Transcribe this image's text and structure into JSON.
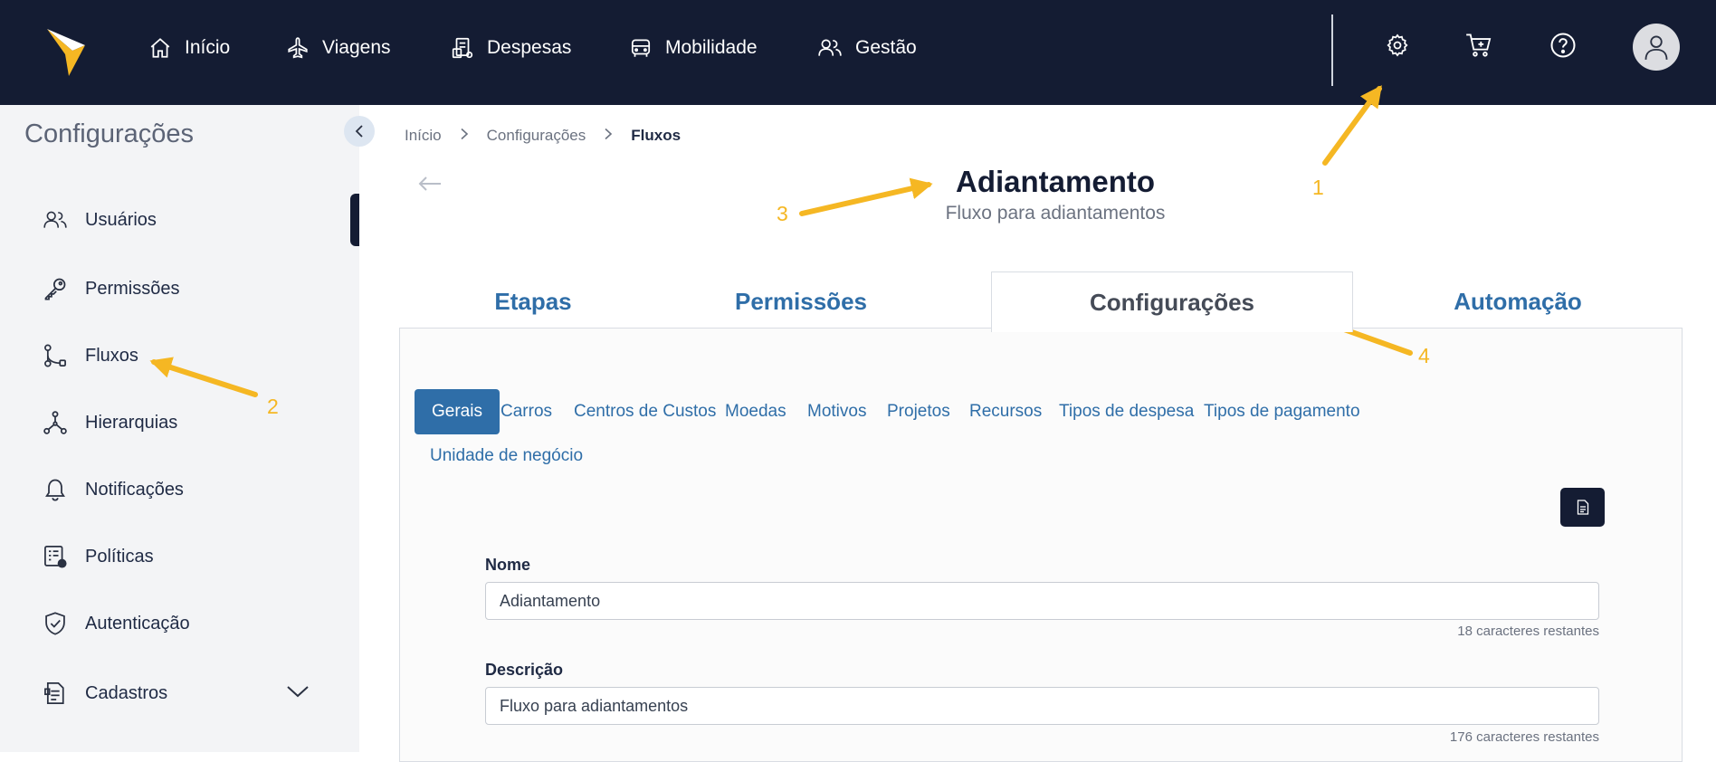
{
  "topnav": {
    "items": [
      {
        "label": "Início",
        "icon": "home-icon"
      },
      {
        "label": "Viagens",
        "icon": "airplane-icon"
      },
      {
        "label": "Despesas",
        "icon": "receipt-icon"
      },
      {
        "label": "Mobilidade",
        "icon": "car-icon"
      },
      {
        "label": "Gestão",
        "icon": "users-icon"
      }
    ],
    "right_icons": [
      "gear-icon",
      "cart-icon",
      "help-icon",
      "user-avatar-icon"
    ]
  },
  "sidebar": {
    "title": "Configurações",
    "items": [
      {
        "label": "Usuários",
        "icon": "users-icon"
      },
      {
        "label": "Permissões",
        "icon": "key-icon"
      },
      {
        "label": "Fluxos",
        "icon": "flow-icon"
      },
      {
        "label": "Hierarquias",
        "icon": "hierarchy-icon"
      },
      {
        "label": "Notificações",
        "icon": "bell-icon"
      },
      {
        "label": "Políticas",
        "icon": "policy-icon"
      },
      {
        "label": "Autenticação",
        "icon": "shield-check-icon"
      },
      {
        "label": "Cadastros",
        "icon": "document-icon"
      }
    ]
  },
  "breadcrumb": [
    "Início",
    "Configurações",
    "Fluxos"
  ],
  "page": {
    "title": "Adiantamento",
    "subtitle": "Fluxo para adiantamentos"
  },
  "tabs": [
    {
      "label": "Etapas",
      "active": false
    },
    {
      "label": "Permissões",
      "active": false
    },
    {
      "label": "Configurações",
      "active": true
    },
    {
      "label": "Automação",
      "active": false
    }
  ],
  "subtabs": [
    {
      "label": "Gerais",
      "active": true
    },
    {
      "label": "Carros"
    },
    {
      "label": "Centros de Custos"
    },
    {
      "label": "Moedas"
    },
    {
      "label": "Motivos"
    },
    {
      "label": "Projetos"
    },
    {
      "label": "Recursos"
    },
    {
      "label": "Tipos de despesa"
    },
    {
      "label": "Tipos de pagamento"
    },
    {
      "label": "Unidade de negócio"
    }
  ],
  "form": {
    "name_label": "Nome",
    "name_value": "Adiantamento",
    "name_hint": "18 caracteres restantes",
    "description_label": "Descrição",
    "description_value": "Fluxo para adiantamentos",
    "description_hint": "176 caracteres restantes"
  },
  "annotations": [
    "1",
    "2",
    "3",
    "4"
  ],
  "colors": {
    "topbar": "#141c33",
    "accent": "#2f6ea8",
    "annotation": "#f5b723",
    "logo": "#f5b723"
  }
}
